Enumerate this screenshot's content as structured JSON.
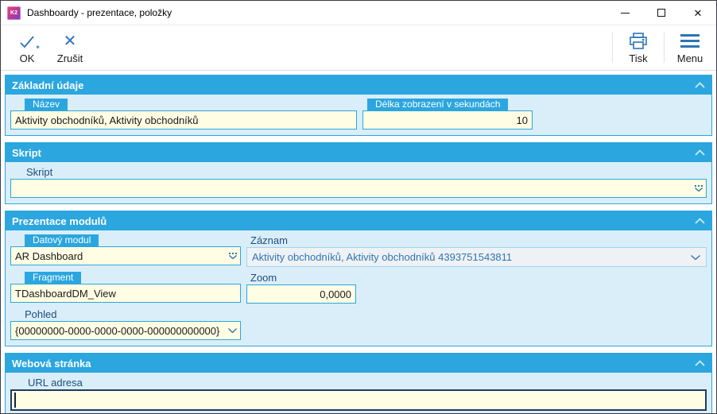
{
  "window": {
    "title": "Dashboardy - prezentace, položky",
    "app_icon_text": "K2"
  },
  "toolbar": {
    "ok_label": "OK",
    "cancel_label": "Zrušit",
    "print_label": "Tisk",
    "menu_label": "Menu"
  },
  "sections": {
    "basic": {
      "title": "Základní údaje",
      "nazev": {
        "label": "Název",
        "value": "Aktivity obchodníků, Aktivity obchodníků"
      },
      "delka": {
        "label": "Délka zobrazení v sekundách",
        "value": "10"
      }
    },
    "skript": {
      "title": "Skript",
      "field": {
        "label": "Skript",
        "value": ""
      }
    },
    "prezentace": {
      "title": "Prezentace modulů",
      "datovy_modul": {
        "label": "Datový modul",
        "value": "AR Dashboard"
      },
      "zaznam": {
        "label": "Záznam",
        "value": "Aktivity obchodníků, Aktivity obchodníků 4393751543811"
      },
      "fragment": {
        "label": "Fragment",
        "value": "TDashboardDM_View"
      },
      "zoom": {
        "label": "Zoom",
        "value": "0,0000"
      },
      "pohled": {
        "label": "Pohled",
        "value": "{00000000-0000-0000-0000-000000000000}"
      }
    },
    "web": {
      "title": "Webová stránka",
      "url": {
        "label": "URL adresa",
        "value": ""
      }
    }
  },
  "colors": {
    "accent_cyan": "#2ba6df",
    "section_body_bg": "#daeefa",
    "field_yellow_bg": "#fffde3",
    "toolbar_icon_blue": "#2e74b5",
    "label_navy": "#1d4e79",
    "readonly_bg": "#eff2f5",
    "readonly_text": "#2f74b6",
    "focus_border_navy": "#1e3a66"
  }
}
